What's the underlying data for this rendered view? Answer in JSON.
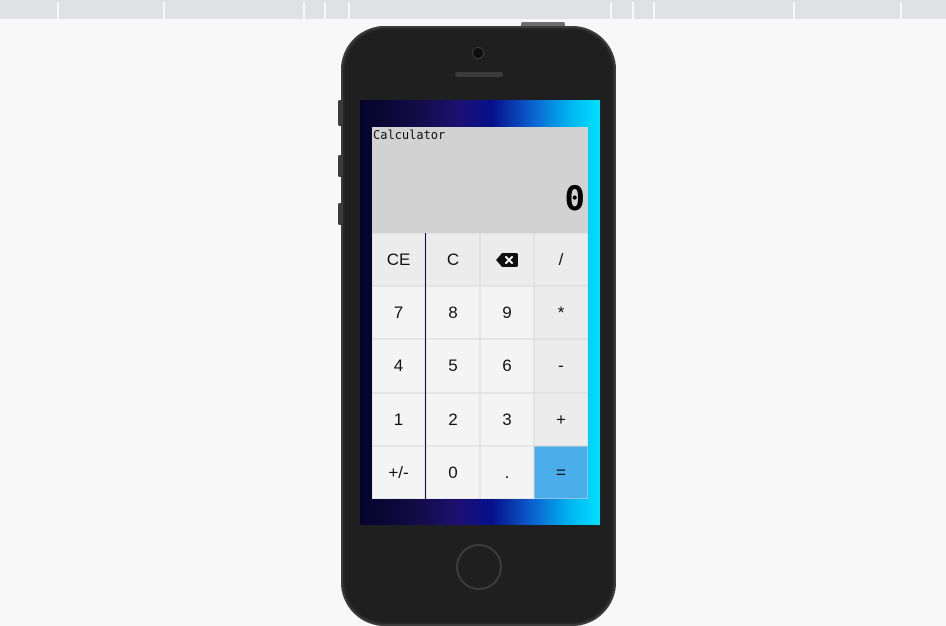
{
  "colors": {
    "equals_key": "#48ade8",
    "display_bg": "#d2d2d2",
    "phone_body": "#1f1f1f"
  },
  "calculator": {
    "title": "Calculator",
    "display_value": "0",
    "keys": [
      {
        "label": "CE",
        "kind": "op"
      },
      {
        "label": "C",
        "kind": "op"
      },
      {
        "label": "",
        "icon": "backspace-icon",
        "kind": "op"
      },
      {
        "label": "/",
        "kind": "op"
      },
      {
        "label": "7",
        "kind": "num"
      },
      {
        "label": "8",
        "kind": "num"
      },
      {
        "label": "9",
        "kind": "num"
      },
      {
        "label": "*",
        "kind": "op"
      },
      {
        "label": "4",
        "kind": "num"
      },
      {
        "label": "5",
        "kind": "num"
      },
      {
        "label": "6",
        "kind": "num"
      },
      {
        "label": "-",
        "kind": "op"
      },
      {
        "label": "1",
        "kind": "num"
      },
      {
        "label": "2",
        "kind": "num"
      },
      {
        "label": "3",
        "kind": "num"
      },
      {
        "label": "+",
        "kind": "op"
      },
      {
        "label": "+/-",
        "kind": "num"
      },
      {
        "label": "0",
        "kind": "num"
      },
      {
        "label": ".",
        "kind": "num"
      },
      {
        "label": "=",
        "kind": "eq"
      }
    ]
  }
}
